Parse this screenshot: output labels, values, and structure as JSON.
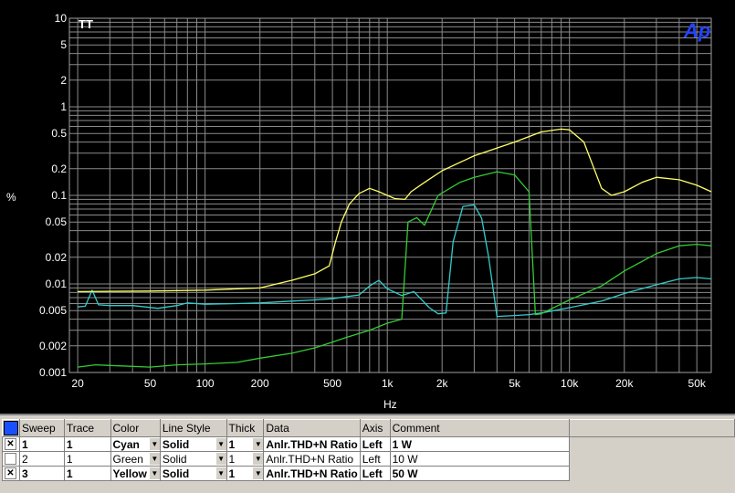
{
  "chart_data": {
    "type": "line",
    "title": "",
    "xlabel": "Hz",
    "ylabel": "%",
    "xscale": "log",
    "yscale": "log",
    "xlim": [
      18,
      60000
    ],
    "ylim": [
      0.001,
      10
    ],
    "xticks": [
      {
        "v": 20,
        "label": "20"
      },
      {
        "v": 50,
        "label": "50"
      },
      {
        "v": 100,
        "label": "100"
      },
      {
        "v": 200,
        "label": "200"
      },
      {
        "v": 500,
        "label": "500"
      },
      {
        "v": 1000,
        "label": "1k"
      },
      {
        "v": 2000,
        "label": "2k"
      },
      {
        "v": 5000,
        "label": "5k"
      },
      {
        "v": 10000,
        "label": "10k"
      },
      {
        "v": 20000,
        "label": "20k"
      },
      {
        "v": 50000,
        "label": "50k"
      }
    ],
    "yticks": [
      {
        "v": 10,
        "label": "10"
      },
      {
        "v": 5,
        "label": "5"
      },
      {
        "v": 2,
        "label": "2"
      },
      {
        "v": 1,
        "label": "1"
      },
      {
        "v": 0.5,
        "label": "0.5"
      },
      {
        "v": 0.2,
        "label": "0.2"
      },
      {
        "v": 0.1,
        "label": "0.1"
      },
      {
        "v": 0.05,
        "label": "0.05"
      },
      {
        "v": 0.02,
        "label": "0.02"
      },
      {
        "v": 0.01,
        "label": "0.01"
      },
      {
        "v": 0.005,
        "label": "0.005"
      },
      {
        "v": 0.002,
        "label": "0.002"
      },
      {
        "v": 0.001,
        "label": "0.001"
      }
    ],
    "grid": true,
    "series": [
      {
        "name": "1 W",
        "color": "#33cccc",
        "points": [
          [
            20,
            0.0055
          ],
          [
            22,
            0.0056
          ],
          [
            24,
            0.0085
          ],
          [
            26,
            0.0058
          ],
          [
            30,
            0.0057
          ],
          [
            40,
            0.0057
          ],
          [
            55,
            0.0053
          ],
          [
            70,
            0.0057
          ],
          [
            80,
            0.0061
          ],
          [
            100,
            0.0059
          ],
          [
            150,
            0.006
          ],
          [
            200,
            0.0061
          ],
          [
            300,
            0.0064
          ],
          [
            400,
            0.0066
          ],
          [
            500,
            0.0068
          ],
          [
            600,
            0.0072
          ],
          [
            700,
            0.0075
          ],
          [
            800,
            0.0095
          ],
          [
            900,
            0.011
          ],
          [
            1000,
            0.0088
          ],
          [
            1200,
            0.0074
          ],
          [
            1400,
            0.0082
          ],
          [
            1700,
            0.0054
          ],
          [
            1900,
            0.0046
          ],
          [
            2100,
            0.0047
          ],
          [
            2300,
            0.03
          ],
          [
            2600,
            0.075
          ],
          [
            3000,
            0.078
          ],
          [
            3300,
            0.055
          ],
          [
            3600,
            0.02
          ],
          [
            4000,
            0.0043
          ],
          [
            5000,
            0.0044
          ],
          [
            6000,
            0.0045
          ],
          [
            7000,
            0.0047
          ],
          [
            10000,
            0.0054
          ],
          [
            15000,
            0.0064
          ],
          [
            20000,
            0.0078
          ],
          [
            30000,
            0.0098
          ],
          [
            40000,
            0.0114
          ],
          [
            50000,
            0.0118
          ],
          [
            60000,
            0.0114
          ]
        ]
      },
      {
        "name": "10 W",
        "color": "#33cc33",
        "points": [
          [
            20,
            0.00115
          ],
          [
            25,
            0.00122
          ],
          [
            30,
            0.0012
          ],
          [
            50,
            0.00115
          ],
          [
            70,
            0.00122
          ],
          [
            100,
            0.00125
          ],
          [
            150,
            0.0013
          ],
          [
            200,
            0.00145
          ],
          [
            300,
            0.00165
          ],
          [
            400,
            0.0019
          ],
          [
            500,
            0.0022
          ],
          [
            600,
            0.0025
          ],
          [
            800,
            0.003
          ],
          [
            1000,
            0.0036
          ],
          [
            1200,
            0.004
          ],
          [
            1300,
            0.05
          ],
          [
            1450,
            0.056
          ],
          [
            1600,
            0.046
          ],
          [
            1900,
            0.1
          ],
          [
            2500,
            0.14
          ],
          [
            3000,
            0.16
          ],
          [
            4000,
            0.185
          ],
          [
            5000,
            0.17
          ],
          [
            6000,
            0.11
          ],
          [
            6500,
            0.0045
          ],
          [
            7000,
            0.0046
          ],
          [
            10000,
            0.0066
          ],
          [
            15000,
            0.0095
          ],
          [
            20000,
            0.014
          ],
          [
            30000,
            0.022
          ],
          [
            40000,
            0.027
          ],
          [
            50000,
            0.028
          ],
          [
            60000,
            0.027
          ]
        ]
      },
      {
        "name": "50 W",
        "color": "#ffff66",
        "points": [
          [
            20,
            0.0082
          ],
          [
            50,
            0.0083
          ],
          [
            100,
            0.0085
          ],
          [
            200,
            0.009
          ],
          [
            300,
            0.011
          ],
          [
            400,
            0.013
          ],
          [
            480,
            0.016
          ],
          [
            520,
            0.03
          ],
          [
            560,
            0.05
          ],
          [
            620,
            0.08
          ],
          [
            700,
            0.105
          ],
          [
            800,
            0.12
          ],
          [
            900,
            0.11
          ],
          [
            1000,
            0.1
          ],
          [
            1100,
            0.092
          ],
          [
            1250,
            0.09
          ],
          [
            1350,
            0.11
          ],
          [
            1600,
            0.14
          ],
          [
            2000,
            0.19
          ],
          [
            3000,
            0.28
          ],
          [
            5000,
            0.4
          ],
          [
            7000,
            0.52
          ],
          [
            9000,
            0.56
          ],
          [
            10000,
            0.55
          ],
          [
            12000,
            0.4
          ],
          [
            15000,
            0.12
          ],
          [
            17000,
            0.1
          ],
          [
            20000,
            0.11
          ],
          [
            25000,
            0.14
          ],
          [
            30000,
            0.16
          ],
          [
            40000,
            0.15
          ],
          [
            50000,
            0.13
          ],
          [
            60000,
            0.11
          ]
        ]
      }
    ]
  },
  "graph": {
    "corner_label": "TT",
    "logo": "Ap",
    "y_unit": "%",
    "x_unit": "Hz"
  },
  "table": {
    "headers": {
      "sweep": "Sweep",
      "trace": "Trace",
      "color": "Color",
      "line_style": "Line Style",
      "thick": "Thick",
      "data": "Data",
      "axis": "Axis",
      "comment": "Comment"
    },
    "rows": [
      {
        "check": "✕",
        "sweep": "1",
        "trace": "1",
        "color": "Cyan",
        "line_style": "Solid",
        "thick": "1",
        "data": "Anlr.THD+N Ratio",
        "axis": "Left",
        "comment": "1 W"
      },
      {
        "check": "",
        "sweep": "2",
        "trace": "1",
        "color": "Green",
        "line_style": "Solid",
        "thick": "1",
        "data": "Anlr.THD+N Ratio",
        "axis": "Left",
        "comment": "10 W"
      },
      {
        "check": "✕",
        "sweep": "3",
        "trace": "1",
        "color": "Yellow",
        "line_style": "Solid",
        "thick": "1",
        "data": "Anlr.THD+N Ratio",
        "axis": "Left",
        "comment": "50 W"
      }
    ]
  }
}
